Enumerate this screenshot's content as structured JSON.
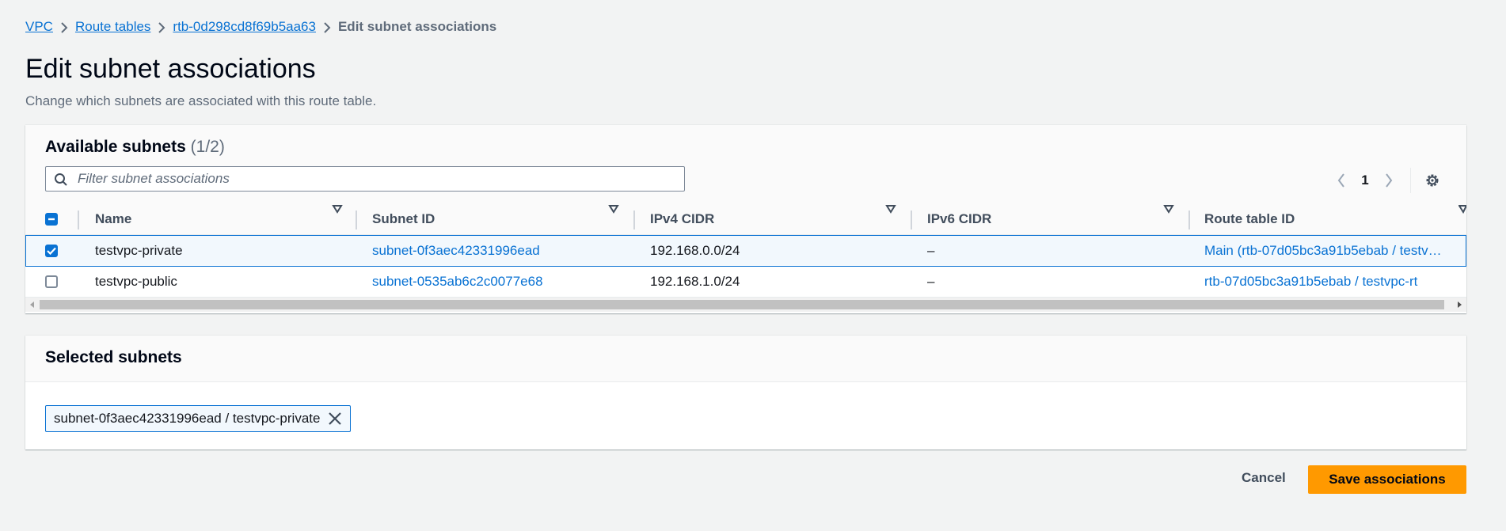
{
  "breadcrumb": {
    "items": [
      "VPC",
      "Route tables",
      "rtb-0d298cd8f69b5aa63"
    ],
    "current": "Edit subnet associations"
  },
  "page": {
    "title": "Edit subnet associations",
    "description": "Change which subnets are associated with this route table."
  },
  "available": {
    "title": "Available subnets",
    "count": "(1/2)",
    "filter_placeholder": "Filter subnet associations",
    "page_number": "1",
    "columns": [
      "Name",
      "Subnet ID",
      "IPv4 CIDR",
      "IPv6 CIDR",
      "Route table ID"
    ],
    "rows": [
      {
        "name": "testvpc-private",
        "subnet_id": "subnet-0f3aec42331996ead",
        "ipv4": "192.168.0.0/24",
        "ipv6": "–",
        "route_table": "Main (rtb-07d05bc3a91b5ebab / testv…",
        "checked": true
      },
      {
        "name": "testvpc-public",
        "subnet_id": "subnet-0535ab6c2c0077e68",
        "ipv4": "192.168.1.0/24",
        "ipv6": "–",
        "route_table": "rtb-07d05bc3a91b5ebab / testvpc-rt",
        "checked": false
      }
    ]
  },
  "selected": {
    "title": "Selected subnets",
    "token": "subnet-0f3aec42331996ead / testvpc-private"
  },
  "actions": {
    "cancel": "Cancel",
    "save": "Save associations"
  },
  "colors": {
    "link": "#0972d3",
    "primary_button": "#ff9900",
    "background": "#f2f3f3"
  }
}
